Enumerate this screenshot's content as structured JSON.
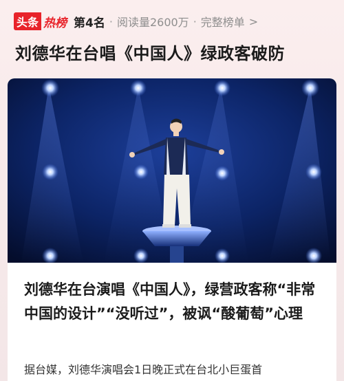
{
  "header": {
    "logo_part1": "头条",
    "logo_part2": "热榜",
    "rank": "第4名",
    "separator": "·",
    "read_count": "阅读量2600万",
    "full_list_link": "完整榜单",
    "chevron": ">"
  },
  "headline": "刘德华在台唱《中国人》绿政客破防",
  "article": {
    "title": "刘德华在台演唱《中国人》，绿营政客称“非常中国的设计”“没听过”，被讽“酸葡萄”心理",
    "snippet": "据台媒，刘德华演唱会1日晚正式在台北小巨蛋首"
  },
  "colors": {
    "brand_red": "#e8232a",
    "stage_blue": "#0a2a78"
  },
  "icons": {
    "chevron": "chevron-right-icon"
  }
}
